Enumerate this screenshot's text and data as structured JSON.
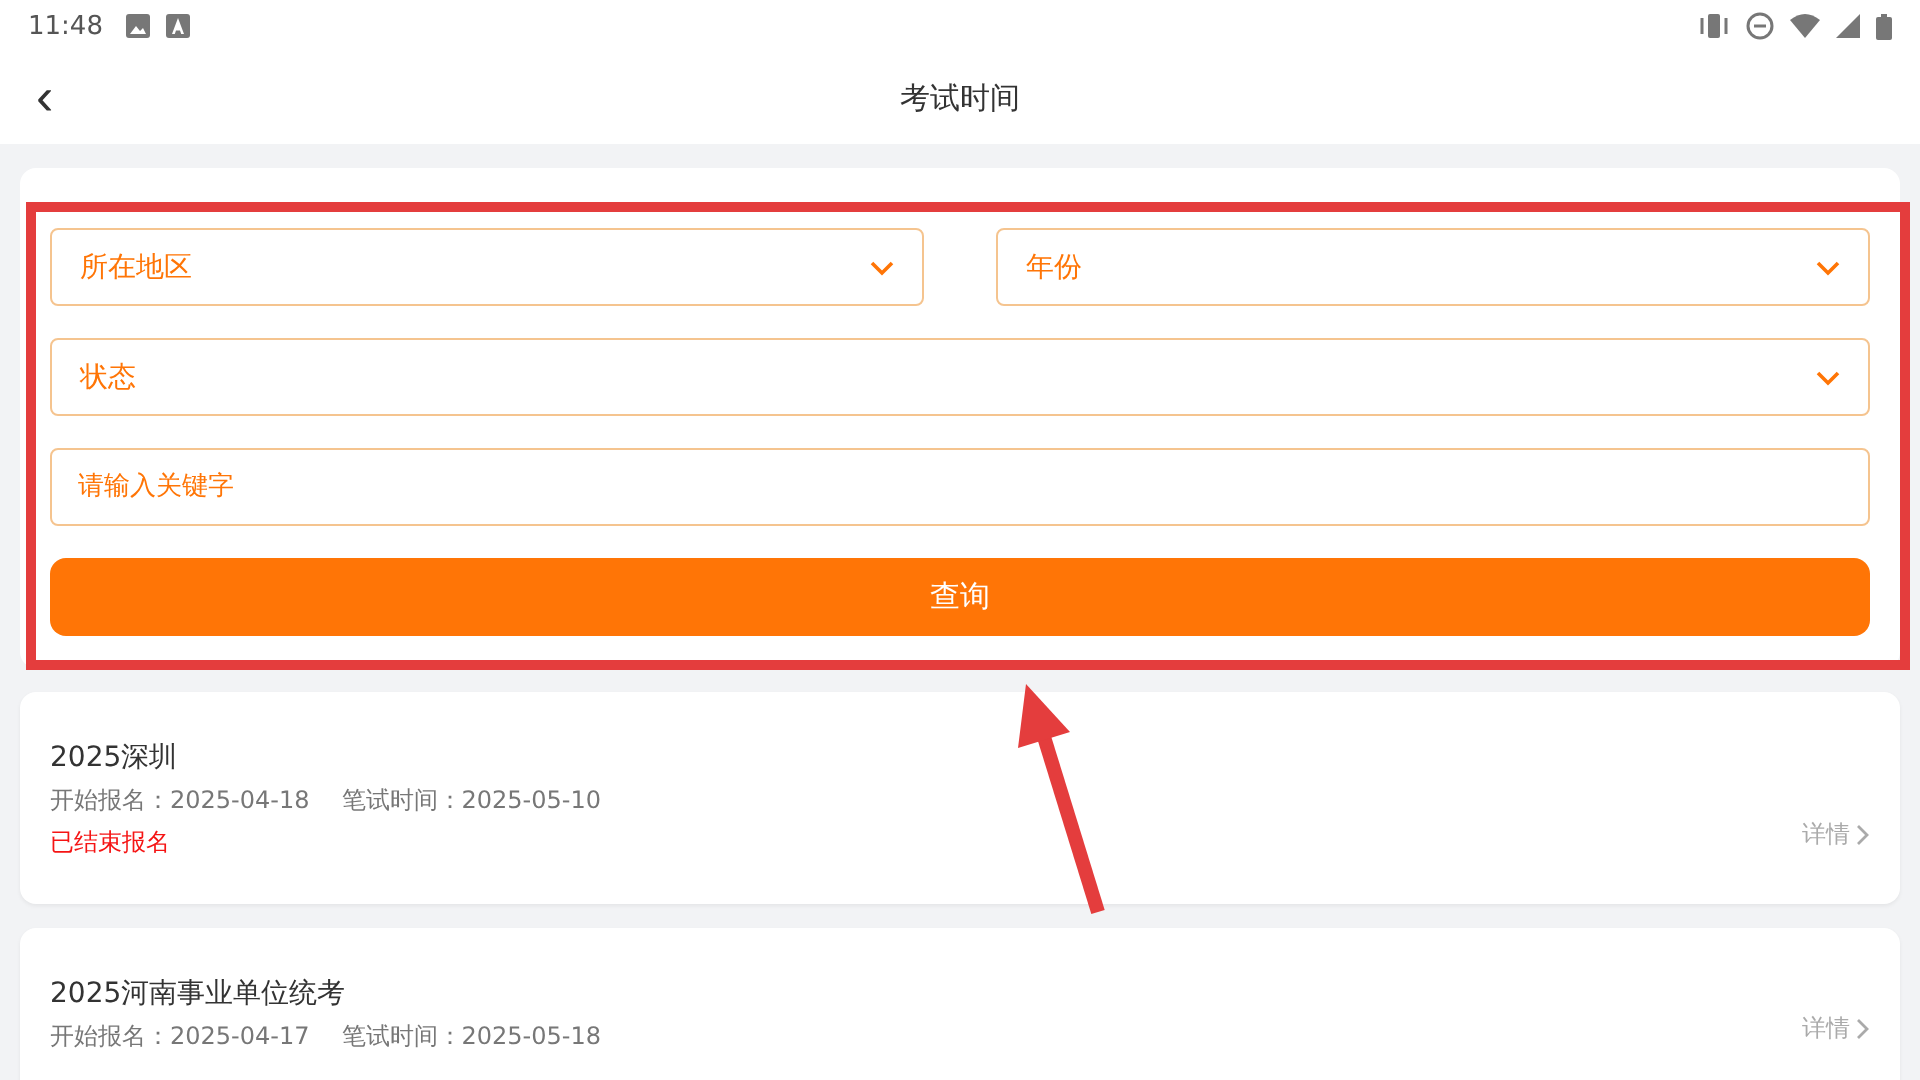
{
  "status_bar": {
    "time": "11:48"
  },
  "header": {
    "back": "‹",
    "title": "考试时间"
  },
  "filters": {
    "dropdowns": [
      {
        "placeholder": "所在地区"
      },
      {
        "placeholder": "年份"
      },
      {
        "placeholder": "状态"
      }
    ],
    "keyword": {
      "placeholder": "请输入关键字"
    },
    "search_button": "查询"
  },
  "exams": [
    {
      "title": "2025深圳",
      "start_label": "开始报名：",
      "start": "2025-04-18",
      "exam_label": "笔试时间：",
      "exam": "2025-05-10",
      "status": "已结束报名",
      "detail": "详情"
    },
    {
      "title": "2025河南事业单位统考",
      "start_label": "开始报名：",
      "start": "2025-04-17",
      "exam_label": "笔试时间：",
      "exam": "2025-05-18",
      "detail": "详情"
    }
  ]
}
